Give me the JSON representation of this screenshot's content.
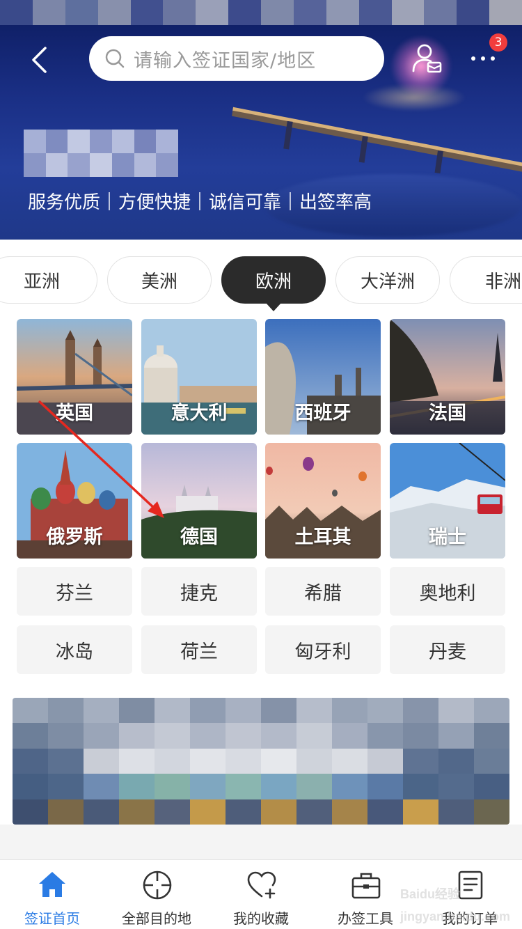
{
  "header": {
    "search_placeholder": "请输入签证国家/地区",
    "notification_count": "3",
    "taglines": [
      "服务优质",
      "方便快捷",
      "诚信可靠",
      "出签率高"
    ]
  },
  "continent_tabs": [
    {
      "label": "亚洲",
      "active": false
    },
    {
      "label": "美洲",
      "active": false
    },
    {
      "label": "欧洲",
      "active": true
    },
    {
      "label": "大洋洲",
      "active": false
    },
    {
      "label": "非洲",
      "active": false
    }
  ],
  "featured_countries": [
    {
      "name": "英国",
      "icon": "tower-bridge-photo"
    },
    {
      "name": "意大利",
      "icon": "venice-church-photo"
    },
    {
      "name": "西班牙",
      "icon": "barcelona-photo"
    },
    {
      "name": "法国",
      "icon": "eiffel-tower-photo"
    },
    {
      "name": "俄罗斯",
      "icon": "st-basil-photo"
    },
    {
      "name": "德国",
      "icon": "neuschwanstein-photo"
    },
    {
      "name": "土耳其",
      "icon": "balloons-photo"
    },
    {
      "name": "瑞士",
      "icon": "cable-car-photo"
    }
  ],
  "other_countries": [
    "芬兰",
    "捷克",
    "希腊",
    "奥地利",
    "冰岛",
    "荷兰",
    "匈牙利",
    "丹麦"
  ],
  "bottom_nav": [
    {
      "label": "签证首页",
      "icon": "home-icon",
      "active": true
    },
    {
      "label": "全部目的地",
      "icon": "crosshair-icon",
      "active": false
    },
    {
      "label": "我的收藏",
      "icon": "heart-plus-icon",
      "active": false
    },
    {
      "label": "办签工具",
      "icon": "briefcase-icon",
      "active": false
    },
    {
      "label": "我的订单",
      "icon": "order-list-icon",
      "active": false
    }
  ],
  "watermark": "Baidu经验 jingyan.baidu.com",
  "colors": {
    "accent": "#2a7be4",
    "active_tab": "#2b2b2b",
    "badge": "#f23d3d"
  }
}
